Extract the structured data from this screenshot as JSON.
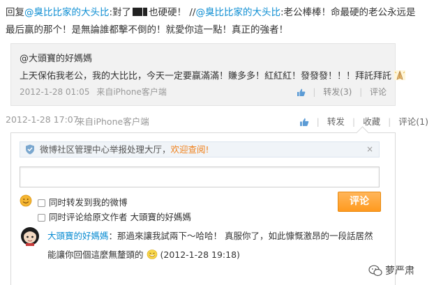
{
  "post": {
    "prefix": "回复",
    "mention1": "@臭比比家的大头比",
    "part1": ":對了",
    "part2": "也硬硬！ //",
    "mention2": "@臭比比家的大头比",
    "part3": ":老公棒棒！命最硬的老公永远是最后赢的那个！是無論誰都擊不倒的！就愛你這一點！真正的強者！"
  },
  "quote": {
    "author": "@大頭寶的好媽媽",
    "text": "上天保佑我老公，我的大比比，今天一定要赢滿滿！賺多多！紅紅紅！發發發！！！拜託拜託",
    "time": "2012-1-28 01:05",
    "source": "来自iPhone客户端",
    "forward": "转发(3)",
    "comment": "评论"
  },
  "meta": {
    "time": "2012-1-28 17:07",
    "source": "来自iPhone客户端",
    "forward": "转发",
    "favorite": "收藏",
    "comment": "评论(1)"
  },
  "notice": {
    "text": "微博社区管理中心举报处理大厅，",
    "link": "欢迎查阅!",
    "close": "×"
  },
  "form": {
    "input_value": "",
    "check1": "同时转发到我的微博",
    "check2": "同时评论给原文作者 大頭寶的好媽媽",
    "submit": "评论"
  },
  "reply": {
    "name": "大頭寶的好媽媽",
    "text1": "：那過來讓我試兩下～哈哈！ 真服你了，如此慷慨激昂的一段話居然能讓你回個這麼無釐頭的",
    "time": "(2012-1-28 19:18)"
  },
  "watermark": "萝严肃",
  "colors": {
    "link": "#0a8cd2",
    "accent": "#ff9a1f",
    "notice_link": "#f0801a"
  }
}
